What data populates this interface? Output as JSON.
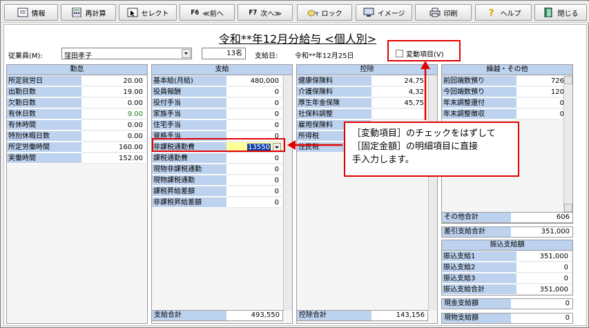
{
  "toolbar": {
    "buttons": [
      {
        "name": "info-button",
        "fkey": "",
        "label": "情報",
        "icon": "info-icon"
      },
      {
        "name": "recalc-button",
        "fkey": "",
        "label": "再計算",
        "icon": "calculator-icon"
      },
      {
        "name": "select-button",
        "fkey": "",
        "label": "セレクト",
        "icon": "select-icon"
      },
      {
        "name": "prev-button",
        "fkey": "F6",
        "label": "≪前へ",
        "icon": ""
      },
      {
        "name": "next-button",
        "fkey": "F7",
        "label": "次へ≫",
        "icon": ""
      },
      {
        "name": "lock-button",
        "fkey": "",
        "label": "ロック",
        "icon": "lock-icon"
      },
      {
        "name": "image-button",
        "fkey": "",
        "label": "イメージ",
        "icon": "monitor-icon"
      },
      {
        "name": "print-button",
        "fkey": "",
        "label": "印刷",
        "icon": "printer-icon"
      },
      {
        "name": "help-button",
        "fkey": "",
        "label": "ヘルプ",
        "icon": "help-icon"
      },
      {
        "name": "close-button",
        "fkey": "",
        "label": "閉じる",
        "icon": "exit-icon"
      }
    ]
  },
  "header": {
    "title": "令和**年12月分給与 <個人別>",
    "employee_label": "従業員(M):",
    "employee_value": "窪田孝子",
    "count": "13名",
    "pay_date_label": "支給日:",
    "pay_date": "令和**年12月25日",
    "variable_item_label": "変動項目(V)",
    "variable_item_checked": false
  },
  "attendance": {
    "header": "勤怠",
    "rows": [
      {
        "label": "所定就労日",
        "value": "20.00"
      },
      {
        "label": "出勤日数",
        "value": "19.00"
      },
      {
        "label": "欠勤日数",
        "value": "0.00"
      },
      {
        "label": "有休日数",
        "value": "9.00"
      },
      {
        "label": "有休時間",
        "value": "0.00"
      },
      {
        "label": "特別休暇日数",
        "value": "0.00"
      },
      {
        "label": "所定労働時間",
        "value": "160.00"
      },
      {
        "label": "実働時間",
        "value": "152.00"
      }
    ]
  },
  "payment": {
    "header": "支給",
    "rows": [
      {
        "label": "基本給(月給)",
        "value": "480,000"
      },
      {
        "label": "役員報酬",
        "value": "0"
      },
      {
        "label": "役付手当",
        "value": "0"
      },
      {
        "label": "家族手当",
        "value": "0"
      },
      {
        "label": "住宅手当",
        "value": "0"
      },
      {
        "label": "資格手当",
        "value": "0"
      },
      {
        "label": "非課税通勤費",
        "value": "13550"
      },
      {
        "label": "課税通勤費",
        "value": "0"
      },
      {
        "label": "現物非課税通勤",
        "value": "0"
      },
      {
        "label": "現物課税通勤",
        "value": "0"
      },
      {
        "label": "課税昇給差額",
        "value": "0"
      },
      {
        "label": "非課税昇給差額",
        "value": "0"
      }
    ],
    "total_label": "支給合計",
    "total": "493,550"
  },
  "deduction": {
    "header": "控除",
    "rows": [
      {
        "label": "健康保険料",
        "value": "24,75"
      },
      {
        "label": "介護保険料",
        "value": "4,32"
      },
      {
        "label": "厚生年金保険",
        "value": "45,75"
      },
      {
        "label": "社保料調整",
        "value": ""
      },
      {
        "label": "雇用保険料",
        "value": ""
      },
      {
        "label": "所得税",
        "value": ""
      },
      {
        "label": "住民税",
        "value": ""
      }
    ],
    "total_label": "控除合計",
    "total": "143,156"
  },
  "carryover": {
    "header": "繰越・その他",
    "rows": [
      {
        "label": "前回端数預り",
        "value": "726"
      },
      {
        "label": "今回端数預り",
        "value": "120"
      },
      {
        "label": "年末調整還付",
        "value": "0"
      },
      {
        "label": "年末調整徴収",
        "value": "0"
      }
    ],
    "other_total_label": "その他合計",
    "other_total": "606",
    "net_label": "差引支給合計",
    "net": "351,000"
  },
  "transfer": {
    "header": "振込支給額",
    "rows": [
      {
        "label": "振込支給1",
        "value": "351,000"
      },
      {
        "label": "振込支給2",
        "value": "0"
      },
      {
        "label": "振込支給3",
        "value": "0"
      },
      {
        "label": "振込支給合計",
        "value": "351,000"
      }
    ],
    "cash_label": "現金支給額",
    "cash": "0",
    "inkind_label": "現物支給額",
    "inkind": "0"
  },
  "callout": {
    "line1": "［変動項目］のチェックをはずして",
    "line2": "［固定金額］の明細項目に直接",
    "line3": "手入力します。"
  },
  "colors": {
    "highlight_red": "#e00000",
    "row_label_bg": "#bdd2ee",
    "active_cell_bg": "#ffff99",
    "selected_text_bg": "#0a3fa8"
  }
}
